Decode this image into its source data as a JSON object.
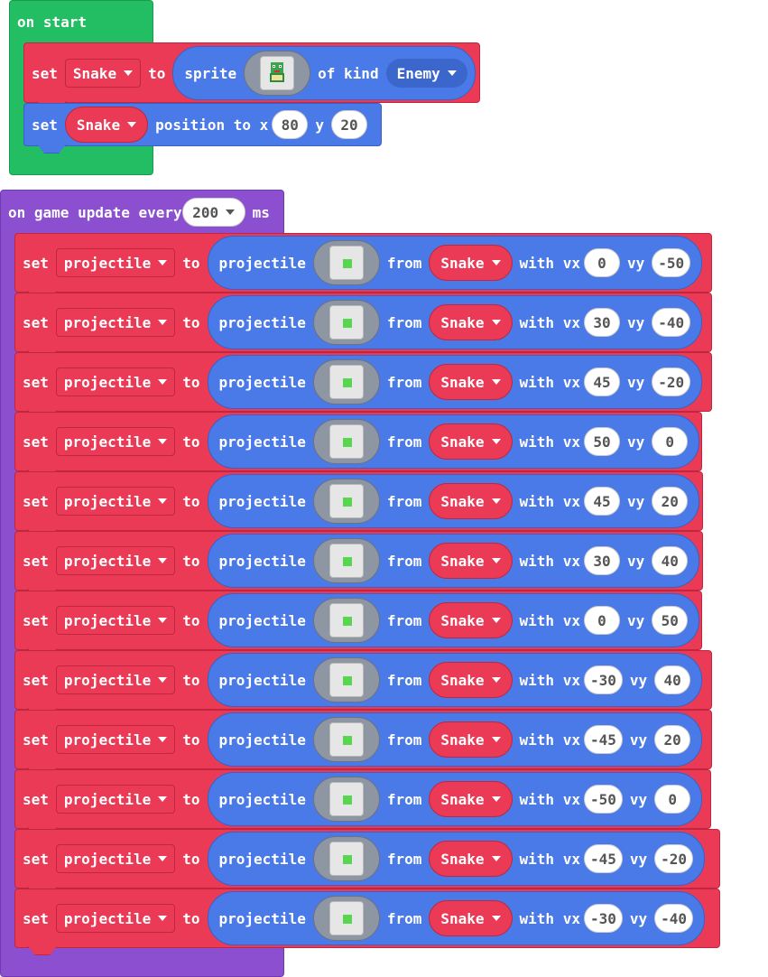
{
  "on_start": {
    "header": "on start",
    "set_sprite": {
      "set": "set",
      "variable": "Snake",
      "to": "to",
      "sprite_label": "sprite",
      "of_kind": "of kind",
      "kind": "Enemy"
    },
    "set_position": {
      "set": "set",
      "variable": "Snake",
      "position_to": "position to x",
      "x": "80",
      "y_label": "y",
      "y": "20"
    }
  },
  "on_update": {
    "header_prefix": "on game update every",
    "interval": "200",
    "unit": "ms",
    "rows": [
      {
        "set": "set",
        "variable": "projectile",
        "to": "to",
        "projectile_label": "projectile",
        "from": "from",
        "source": "Snake",
        "with_vx": "with vx",
        "vx": "0",
        "vy_label": "vy",
        "vy": "-50"
      },
      {
        "set": "set",
        "variable": "projectile",
        "to": "to",
        "projectile_label": "projectile",
        "from": "from",
        "source": "Snake",
        "with_vx": "with vx",
        "vx": "30",
        "vy_label": "vy",
        "vy": "-40"
      },
      {
        "set": "set",
        "variable": "projectile",
        "to": "to",
        "projectile_label": "projectile",
        "from": "from",
        "source": "Snake",
        "with_vx": "with vx",
        "vx": "45",
        "vy_label": "vy",
        "vy": "-20"
      },
      {
        "set": "set",
        "variable": "projectile",
        "to": "to",
        "projectile_label": "projectile",
        "from": "from",
        "source": "Snake",
        "with_vx": "with vx",
        "vx": "50",
        "vy_label": "vy",
        "vy": "0"
      },
      {
        "set": "set",
        "variable": "projectile",
        "to": "to",
        "projectile_label": "projectile",
        "from": "from",
        "source": "Snake",
        "with_vx": "with vx",
        "vx": "45",
        "vy_label": "vy",
        "vy": "20"
      },
      {
        "set": "set",
        "variable": "projectile",
        "to": "to",
        "projectile_label": "projectile",
        "from": "from",
        "source": "Snake",
        "with_vx": "with vx",
        "vx": "30",
        "vy_label": "vy",
        "vy": "40"
      },
      {
        "set": "set",
        "variable": "projectile",
        "to": "to",
        "projectile_label": "projectile",
        "from": "from",
        "source": "Snake",
        "with_vx": "with vx",
        "vx": "0",
        "vy_label": "vy",
        "vy": "50"
      },
      {
        "set": "set",
        "variable": "projectile",
        "to": "to",
        "projectile_label": "projectile",
        "from": "from",
        "source": "Snake",
        "with_vx": "with vx",
        "vx": "-30",
        "vy_label": "vy",
        "vy": "40"
      },
      {
        "set": "set",
        "variable": "projectile",
        "to": "to",
        "projectile_label": "projectile",
        "from": "from",
        "source": "Snake",
        "with_vx": "with vx",
        "vx": "-45",
        "vy_label": "vy",
        "vy": "20"
      },
      {
        "set": "set",
        "variable": "projectile",
        "to": "to",
        "projectile_label": "projectile",
        "from": "from",
        "source": "Snake",
        "with_vx": "with vx",
        "vx": "-50",
        "vy_label": "vy",
        "vy": "0"
      },
      {
        "set": "set",
        "variable": "projectile",
        "to": "to",
        "projectile_label": "projectile",
        "from": "from",
        "source": "Snake",
        "with_vx": "with vx",
        "vx": "-45",
        "vy_label": "vy",
        "vy": "-20"
      },
      {
        "set": "set",
        "variable": "projectile",
        "to": "to",
        "projectile_label": "projectile",
        "from": "from",
        "source": "Snake",
        "with_vx": "with vx",
        "vx": "-30",
        "vy_label": "vy",
        "vy": "-40"
      }
    ]
  },
  "colors": {
    "events_green": "#23bd63",
    "game_purple": "#8b4fcf",
    "variables_red": "#ea3a55",
    "sprites_blue": "#4a79e8",
    "image_gray": "#8e95a3"
  },
  "icons": {
    "sprite_image": "snake-sprite-icon",
    "projectile_image": "green-dot-projectile-icon",
    "dropdown": "caret-down-icon"
  }
}
